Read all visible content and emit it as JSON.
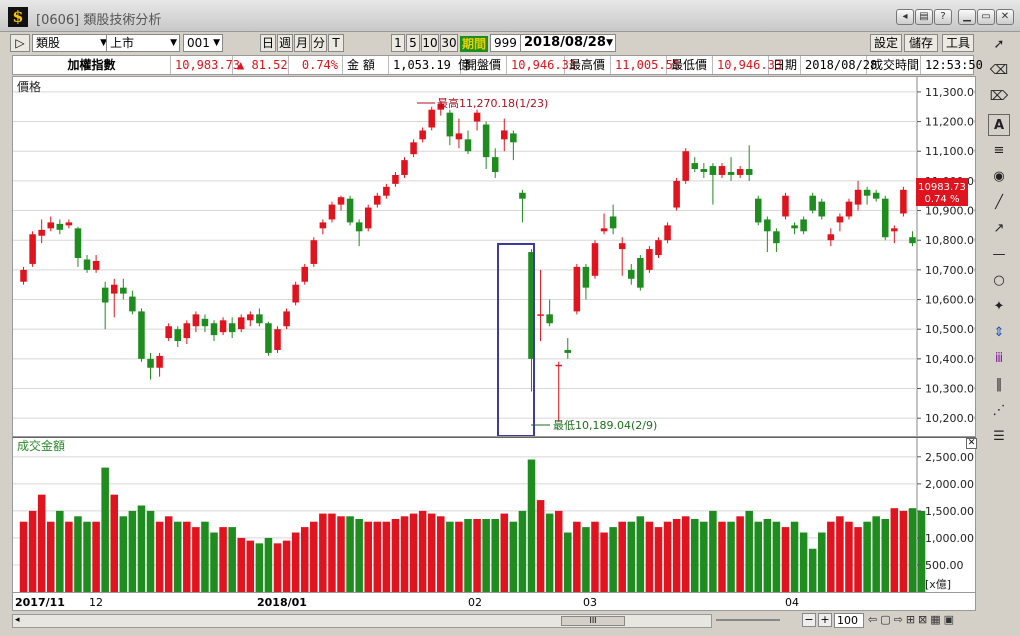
{
  "window": {
    "title": "[0606] 類股技術分析",
    "logo": "$"
  },
  "toolbar": {
    "category": "類股",
    "market": "上市",
    "code": "001",
    "period_buttons": [
      "日",
      "週",
      "月",
      "分",
      "T"
    ],
    "interval_buttons": [
      "1",
      "5",
      "10",
      "30"
    ],
    "period_label": "期間",
    "period_count": "999",
    "date": "2018/08/28",
    "settings": "設定",
    "save": "儲存",
    "tools": "工具"
  },
  "info": {
    "name": "加權指數",
    "price": "10,983.73",
    "change": "▲ 81.52",
    "change_pct": "0.74%",
    "amount_label": "金 額",
    "amount": "1,053.19 億",
    "open_label": "開盤價",
    "open": "10,946.33",
    "high_label": "最高價",
    "high": "11,005.55",
    "low_label": "最低價",
    "low": "10,946.33",
    "date_label": "日期",
    "date": "2018/08/28",
    "time_label": "成交時間",
    "time": "12:53:50"
  },
  "price_panel": {
    "label": "價格",
    "current_tag": "10983.73",
    "current_tag_pct": "0.74 %",
    "high_annotation": "最高11,270.18(1/23)",
    "low_annotation": "最低10,189.04(2/9)"
  },
  "volume_panel": {
    "label": "成交金額",
    "unit": "[x億]"
  },
  "x_axis": {
    "labels": [
      "2017/11",
      "12",
      "2018/01",
      "02",
      "03",
      "04"
    ]
  },
  "bottom": {
    "zoom": "100",
    "scroll_label": "III"
  },
  "colors": {
    "up": "#e0141e",
    "down": "#1e8c1e",
    "grid": "#d8d8d8",
    "highlight_box": "#3c3ca0"
  },
  "chart_data": {
    "type": "candlestick",
    "title": "加權指數",
    "ylim": [
      10150,
      11330
    ],
    "yticks": [
      10200,
      10300,
      10400,
      10500,
      10600,
      10700,
      10800,
      10900,
      11000,
      11100,
      11200,
      11300
    ],
    "volume_ylim": [
      0,
      2700
    ],
    "volume_yticks": [
      500,
      1000,
      1500,
      2000,
      2500
    ],
    "candles": [
      {
        "o": 10660,
        "c": 10700,
        "h": 10710,
        "l": 10650
      },
      {
        "o": 10720,
        "c": 10820,
        "h": 10830,
        "l": 10710
      },
      {
        "o": 10815,
        "c": 10835,
        "h": 10870,
        "l": 10790
      },
      {
        "o": 10840,
        "c": 10860,
        "h": 10880,
        "l": 10830
      },
      {
        "o": 10855,
        "c": 10835,
        "h": 10870,
        "l": 10820
      },
      {
        "o": 10850,
        "c": 10860,
        "h": 10870,
        "l": 10840
      },
      {
        "o": 10840,
        "c": 10740,
        "h": 10845,
        "l": 10710
      },
      {
        "o": 10735,
        "c": 10700,
        "h": 10750,
        "l": 10690
      },
      {
        "o": 10700,
        "c": 10730,
        "h": 10750,
        "l": 10690
      },
      {
        "o": 10640,
        "c": 10590,
        "h": 10660,
        "l": 10500
      },
      {
        "o": 10620,
        "c": 10650,
        "h": 10670,
        "l": 10540
      },
      {
        "o": 10640,
        "c": 10620,
        "h": 10670,
        "l": 10600
      },
      {
        "o": 10610,
        "c": 10560,
        "h": 10630,
        "l": 10550
      },
      {
        "o": 10560,
        "c": 10400,
        "h": 10570,
        "l": 10390
      },
      {
        "o": 10400,
        "c": 10370,
        "h": 10420,
        "l": 10330
      },
      {
        "o": 10370,
        "c": 10410,
        "h": 10420,
        "l": 10340
      },
      {
        "o": 10470,
        "c": 10510,
        "h": 10520,
        "l": 10460
      },
      {
        "o": 10500,
        "c": 10460,
        "h": 10510,
        "l": 10440
      },
      {
        "o": 10470,
        "c": 10520,
        "h": 10530,
        "l": 10450
      },
      {
        "o": 10510,
        "c": 10550,
        "h": 10560,
        "l": 10490
      },
      {
        "o": 10535,
        "c": 10510,
        "h": 10550,
        "l": 10490
      },
      {
        "o": 10520,
        "c": 10480,
        "h": 10530,
        "l": 10460
      },
      {
        "o": 10490,
        "c": 10530,
        "h": 10540,
        "l": 10480
      },
      {
        "o": 10520,
        "c": 10490,
        "h": 10540,
        "l": 10470
      },
      {
        "o": 10500,
        "c": 10540,
        "h": 10550,
        "l": 10490
      },
      {
        "o": 10530,
        "c": 10550,
        "h": 10560,
        "l": 10510
      },
      {
        "o": 10550,
        "c": 10520,
        "h": 10570,
        "l": 10510
      },
      {
        "o": 10520,
        "c": 10420,
        "h": 10525,
        "l": 10410
      },
      {
        "o": 10430,
        "c": 10500,
        "h": 10510,
        "l": 10420
      },
      {
        "o": 10510,
        "c": 10560,
        "h": 10570,
        "l": 10500
      },
      {
        "o": 10590,
        "c": 10650,
        "h": 10660,
        "l": 10580
      },
      {
        "o": 10660,
        "c": 10710,
        "h": 10720,
        "l": 10650
      },
      {
        "o": 10720,
        "c": 10800,
        "h": 10810,
        "l": 10710
      },
      {
        "o": 10840,
        "c": 10860,
        "h": 10870,
        "l": 10820
      },
      {
        "o": 10870,
        "c": 10920,
        "h": 10930,
        "l": 10860
      },
      {
        "o": 10920,
        "c": 10945,
        "h": 10950,
        "l": 10900
      },
      {
        "o": 10940,
        "c": 10860,
        "h": 10950,
        "l": 10850
      },
      {
        "o": 10860,
        "c": 10830,
        "h": 10870,
        "l": 10780
      },
      {
        "o": 10840,
        "c": 10910,
        "h": 10920,
        "l": 10830
      },
      {
        "o": 10920,
        "c": 10950,
        "h": 10960,
        "l": 10910
      },
      {
        "o": 10950,
        "c": 10980,
        "h": 10990,
        "l": 10940
      },
      {
        "o": 10990,
        "c": 11020,
        "h": 11030,
        "l": 10980
      },
      {
        "o": 11020,
        "c": 11070,
        "h": 11080,
        "l": 11010
      },
      {
        "o": 11090,
        "c": 11130,
        "h": 11140,
        "l": 11080
      },
      {
        "o": 11140,
        "c": 11170,
        "h": 11180,
        "l": 11130
      },
      {
        "o": 11180,
        "c": 11240,
        "h": 11250,
        "l": 11170
      },
      {
        "o": 11240,
        "c": 11260,
        "h": 11270.18,
        "l": 11220
      },
      {
        "o": 11230,
        "c": 11150,
        "h": 11240,
        "l": 11120
      },
      {
        "o": 11140,
        "c": 11160,
        "h": 11210,
        "l": 11110
      },
      {
        "o": 11140,
        "c": 11100,
        "h": 11170,
        "l": 11090
      },
      {
        "o": 11200,
        "c": 11230,
        "h": 11240,
        "l": 11170
      },
      {
        "o": 11190,
        "c": 11080,
        "h": 11200,
        "l": 11040
      },
      {
        "o": 11080,
        "c": 11030,
        "h": 11110,
        "l": 11010
      },
      {
        "o": 11140,
        "c": 11170,
        "h": 11210,
        "l": 11100
      },
      {
        "o": 11160,
        "c": 11130,
        "h": 11170,
        "l": 11070
      },
      {
        "o": 10960,
        "c": 10940,
        "h": 10970,
        "l": 10860
      },
      {
        "o": 10760,
        "c": 10400,
        "h": 10770,
        "l": 10290
      },
      {
        "o": 10550,
        "c": 10550,
        "h": 10700,
        "l": 10460
      },
      {
        "o": 10550,
        "c": 10520,
        "h": 10600,
        "l": 10510
      },
      {
        "o": 10380,
        "c": 10380,
        "h": 10390,
        "l": 10189.04
      },
      {
        "o": 10430,
        "c": 10420,
        "h": 10470,
        "l": 10400
      },
      {
        "o": 10560,
        "c": 10710,
        "h": 10720,
        "l": 10550
      },
      {
        "o": 10710,
        "c": 10640,
        "h": 10720,
        "l": 10600
      },
      {
        "o": 10680,
        "c": 10790,
        "h": 10800,
        "l": 10670
      },
      {
        "o": 10830,
        "c": 10840,
        "h": 10890,
        "l": 10820
      },
      {
        "o": 10880,
        "c": 10840,
        "h": 10920,
        "l": 10820
      },
      {
        "o": 10770,
        "c": 10790,
        "h": 10810,
        "l": 10680
      },
      {
        "o": 10700,
        "c": 10670,
        "h": 10720,
        "l": 10650
      },
      {
        "o": 10740,
        "c": 10640,
        "h": 10750,
        "l": 10630
      },
      {
        "o": 10700,
        "c": 10770,
        "h": 10780,
        "l": 10690
      },
      {
        "o": 10750,
        "c": 10800,
        "h": 10810,
        "l": 10740
      },
      {
        "o": 10800,
        "c": 10850,
        "h": 10860,
        "l": 10790
      },
      {
        "o": 10910,
        "c": 11000,
        "h": 11010,
        "l": 10900
      },
      {
        "o": 11000,
        "c": 11100,
        "h": 11110,
        "l": 10990
      },
      {
        "o": 11060,
        "c": 11040,
        "h": 11080,
        "l": 11030
      },
      {
        "o": 11040,
        "c": 11030,
        "h": 11060,
        "l": 11010
      },
      {
        "o": 11050,
        "c": 11020,
        "h": 11060,
        "l": 10920
      },
      {
        "o": 11020,
        "c": 11050,
        "h": 11060,
        "l": 11010
      },
      {
        "o": 11030,
        "c": 11020,
        "h": 11080,
        "l": 11000
      },
      {
        "o": 11020,
        "c": 11040,
        "h": 11050,
        "l": 11010
      },
      {
        "o": 11040,
        "c": 11020,
        "h": 11120,
        "l": 11000
      },
      {
        "o": 10940,
        "c": 10860,
        "h": 10950,
        "l": 10850
      },
      {
        "o": 10870,
        "c": 10830,
        "h": 10880,
        "l": 10760
      },
      {
        "o": 10830,
        "c": 10790,
        "h": 10840,
        "l": 10760
      },
      {
        "o": 10880,
        "c": 10950,
        "h": 10960,
        "l": 10870
      },
      {
        "o": 10850,
        "c": 10840,
        "h": 10860,
        "l": 10820
      },
      {
        "o": 10870,
        "c": 10830,
        "h": 10880,
        "l": 10820
      },
      {
        "o": 10950,
        "c": 10900,
        "h": 10960,
        "l": 10890
      },
      {
        "o": 10930,
        "c": 10880,
        "h": 10940,
        "l": 10870
      },
      {
        "o": 10800,
        "c": 10820,
        "h": 10840,
        "l": 10780
      },
      {
        "o": 10860,
        "c": 10880,
        "h": 10890,
        "l": 10830
      },
      {
        "o": 10880,
        "c": 10930,
        "h": 10940,
        "l": 10870
      },
      {
        "o": 10920,
        "c": 10970,
        "h": 11000,
        "l": 10900
      },
      {
        "o": 10970,
        "c": 10950,
        "h": 10980,
        "l": 10920
      },
      {
        "o": 10960,
        "c": 10940,
        "h": 10970,
        "l": 10930
      },
      {
        "o": 10940,
        "c": 10810,
        "h": 10950,
        "l": 10800
      },
      {
        "o": 10830,
        "c": 10840,
        "h": 10850,
        "l": 10790
      },
      {
        "o": 10890,
        "c": 10970,
        "h": 10980,
        "l": 10880
      },
      {
        "o": 10810,
        "c": 10790,
        "h": 10830,
        "l": 10780
      }
    ],
    "volume": [
      1300,
      1500,
      1800,
      1300,
      1500,
      1300,
      1400,
      1300,
      1300,
      2300,
      1800,
      1400,
      1500,
      1600,
      1500,
      1300,
      1400,
      1300,
      1300,
      1200,
      1300,
      1100,
      1200,
      1200,
      1000,
      950,
      900,
      1000,
      900,
      950,
      1100,
      1200,
      1300,
      1450,
      1450,
      1400,
      1400,
      1350,
      1300,
      1300,
      1300,
      1350,
      1400,
      1450,
      1500,
      1450,
      1400,
      1300,
      1300,
      1350,
      1350,
      1350,
      1350,
      1450,
      1300,
      1500,
      2450,
      1700,
      1450,
      1500,
      1100,
      1300,
      1200,
      1300,
      1100,
      1200,
      1300,
      1300,
      1400,
      1300,
      1200,
      1300,
      1350,
      1400,
      1350,
      1300,
      1500,
      1300,
      1300,
      1400,
      1500,
      1300,
      1350,
      1300,
      1200,
      1300,
      1100,
      800,
      1100,
      1300,
      1400,
      1300,
      1200,
      1300,
      1400,
      1350,
      1550,
      1500,
      1550,
      1500
    ]
  }
}
